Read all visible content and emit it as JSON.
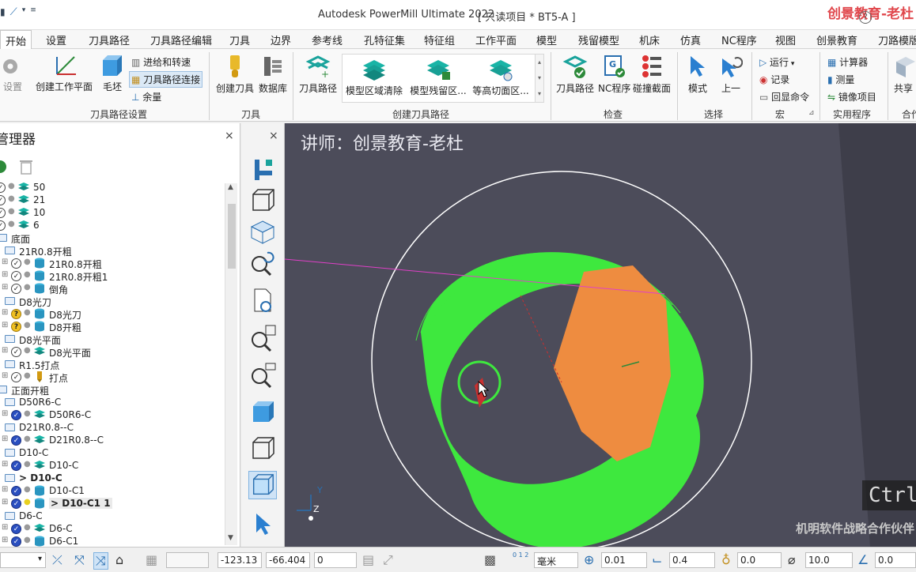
{
  "titlebar": {
    "app_title": "Autodesk PowerMill Ultimate 2022",
    "project": "[ 只读项目 * BT5-A ]",
    "watermark": "创景教育-老杜",
    "help": "?"
  },
  "tabs": [
    "开始",
    "设置",
    "刀具路径",
    "刀具路径编辑",
    "刀具",
    "边界",
    "参考线",
    "孔特征集",
    "特征组",
    "工作平面",
    "模型",
    "残留模型",
    "机床",
    "仿真",
    "NC程序",
    "视图",
    "创景教育",
    "刀路模版"
  ],
  "ribbon": {
    "setup_group": {
      "label": "刀具路径设置",
      "settings": "设置",
      "create_workplane": "创建工作平面",
      "block": "毛坯",
      "leads_links": "进给和转速",
      "toolpath_connections": "刀具路径连接",
      "thickness": "余量"
    },
    "tool_group": {
      "label": "刀具",
      "create_tool": "创建刀具",
      "database": "数据库"
    },
    "create_toolpath_group": {
      "label": "创建刀具路径",
      "toolpath": "刀具路径",
      "model_area_clearance": "模型区域清除",
      "model_rest_clearance": "模型残留区...",
      "constant_z": "等高切面区..."
    },
    "verify_group": {
      "label": "检查",
      "toolpath": "刀具路径",
      "nc_program": "NC程序",
      "collision": "碰撞截面"
    },
    "select_group": {
      "label": "选择",
      "mode": "模式",
      "previous": "上一"
    },
    "macro_group": {
      "label": "宏",
      "run": "运行",
      "record": "记录",
      "echo": "回显命令"
    },
    "utility_group": {
      "label": "实用程序",
      "calculator": "计算器",
      "measure": "测量",
      "mirror": "镜像项目"
    },
    "share_group": {
      "label": "合作",
      "share": "共享"
    }
  },
  "explorer": {
    "title": "管理器",
    "close": "×",
    "tree": [
      {
        "label": "50",
        "indent": 0,
        "status": "check",
        "icon": "layer"
      },
      {
        "label": "21",
        "indent": 0,
        "status": "check",
        "icon": "layer"
      },
      {
        "label": "10",
        "indent": 0,
        "status": "check",
        "icon": "layer"
      },
      {
        "label": "6",
        "indent": 0,
        "status": "check",
        "icon": "layer"
      },
      {
        "label": "底面",
        "indent": 0,
        "status": "folder",
        "icon": "none"
      },
      {
        "label": "21R0.8开粗",
        "indent": 1,
        "status": "folder",
        "icon": "none"
      },
      {
        "label": "21R0.8开粗",
        "indent": 2,
        "status": "check",
        "icon": "db"
      },
      {
        "label": "21R0.8开粗1",
        "indent": 2,
        "status": "check",
        "icon": "db"
      },
      {
        "label": "倒角",
        "indent": 2,
        "status": "check",
        "icon": "db"
      },
      {
        "label": "D8光刀",
        "indent": 1,
        "status": "folder",
        "icon": "none"
      },
      {
        "label": "D8光刀",
        "indent": 2,
        "status": "question",
        "icon": "db"
      },
      {
        "label": "D8开粗",
        "indent": 2,
        "status": "question",
        "icon": "db"
      },
      {
        "label": "D8光平面",
        "indent": 1,
        "status": "folder",
        "icon": "none"
      },
      {
        "label": "D8光平面",
        "indent": 2,
        "status": "check",
        "icon": "layer"
      },
      {
        "label": "R1.5打点",
        "indent": 1,
        "status": "folder",
        "icon": "none"
      },
      {
        "label": "打点",
        "indent": 2,
        "status": "check",
        "icon": "drill"
      },
      {
        "label": "正面开粗",
        "indent": 0,
        "status": "folder",
        "icon": "none"
      },
      {
        "label": "D50R6-C",
        "indent": 1,
        "status": "folder",
        "icon": "none"
      },
      {
        "label": "D50R6-C",
        "indent": 2,
        "status": "blue",
        "icon": "layer"
      },
      {
        "label": "D21R0.8--C",
        "indent": 1,
        "status": "folder",
        "icon": "none"
      },
      {
        "label": "D21R0.8--C",
        "indent": 2,
        "status": "blue",
        "icon": "layer"
      },
      {
        "label": "D10-C",
        "indent": 1,
        "status": "folder",
        "icon": "none"
      },
      {
        "label": "D10-C",
        "indent": 2,
        "status": "blue",
        "icon": "layer"
      },
      {
        "label": "> D10-C",
        "indent": 1,
        "status": "folder",
        "icon": "none",
        "bold": true
      },
      {
        "label": "D10-C1",
        "indent": 2,
        "status": "blue",
        "icon": "db"
      },
      {
        "label": "> D10-C1 1",
        "indent": 2,
        "status": "blue",
        "icon": "db",
        "bold": true,
        "bulb": "on"
      },
      {
        "label": "D6-C",
        "indent": 1,
        "status": "folder",
        "icon": "none"
      },
      {
        "label": "D6-C",
        "indent": 2,
        "status": "blue",
        "icon": "layer"
      },
      {
        "label": "D6-C1",
        "indent": 2,
        "status": "blue",
        "icon": "db"
      }
    ]
  },
  "viewtools": {
    "close": "×"
  },
  "viewport": {
    "lecturer": "讲师：创景教育-老杜",
    "ctrl_hint": "Ctrl",
    "bottom_watermark": "机明软件战略合作伙伴",
    "axis_y": "Y",
    "axis_z": "Z",
    "colors": {
      "background": "#4c4c5a",
      "toolpath": "#3ee83e",
      "model": "#ee8c40",
      "boundary": "#ffffff",
      "line": "#e040c8"
    }
  },
  "statusbar": {
    "x": "-123.13",
    "y": "-66.404",
    "z": "0",
    "units": "毫米",
    "tolerance": "0.01",
    "thickness": "0.4",
    "tool_dia": "0.0",
    "diameter": "10.0",
    "angle": "0.0",
    "unit_icon_text": "0 1 2"
  }
}
